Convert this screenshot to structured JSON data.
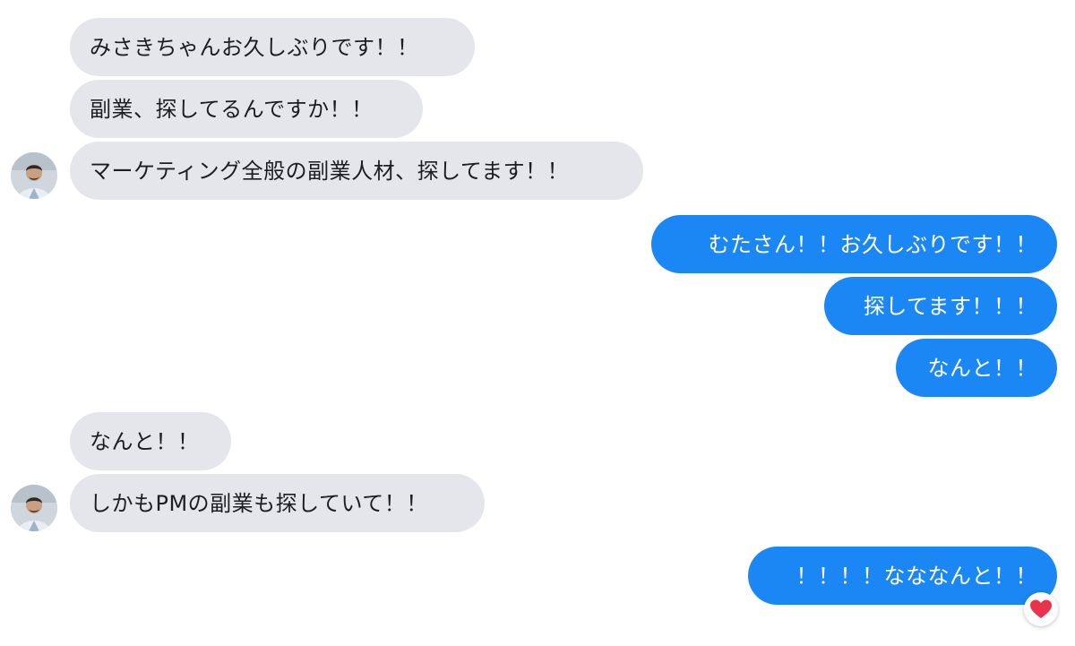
{
  "conversation": {
    "messages": [
      {
        "direction": "incoming",
        "text": "みさきちゃんお久しぶりです！！"
      },
      {
        "direction": "incoming",
        "text": "副業、探してるんですか！！"
      },
      {
        "direction": "incoming",
        "text": "マーケティング全般の副業人材、探してます！！"
      },
      {
        "direction": "outgoing",
        "text": "むたさん！！お久しぶりです！！"
      },
      {
        "direction": "outgoing",
        "text": "探してます！！！"
      },
      {
        "direction": "outgoing",
        "text": "なんと！！"
      },
      {
        "direction": "incoming",
        "text": "なんと！！"
      },
      {
        "direction": "incoming",
        "text": "しかもPMの副業も探していて！！"
      },
      {
        "direction": "outgoing",
        "text": "！！！！なななんと！！"
      }
    ],
    "reaction": {
      "icon": "heart-icon",
      "color": "#e8334a"
    }
  },
  "colors": {
    "incoming_bubble": "#e4e6eb",
    "incoming_text": "#1c1e21",
    "outgoing_bubble": "#1b87f5",
    "outgoing_text": "#ffffff"
  }
}
